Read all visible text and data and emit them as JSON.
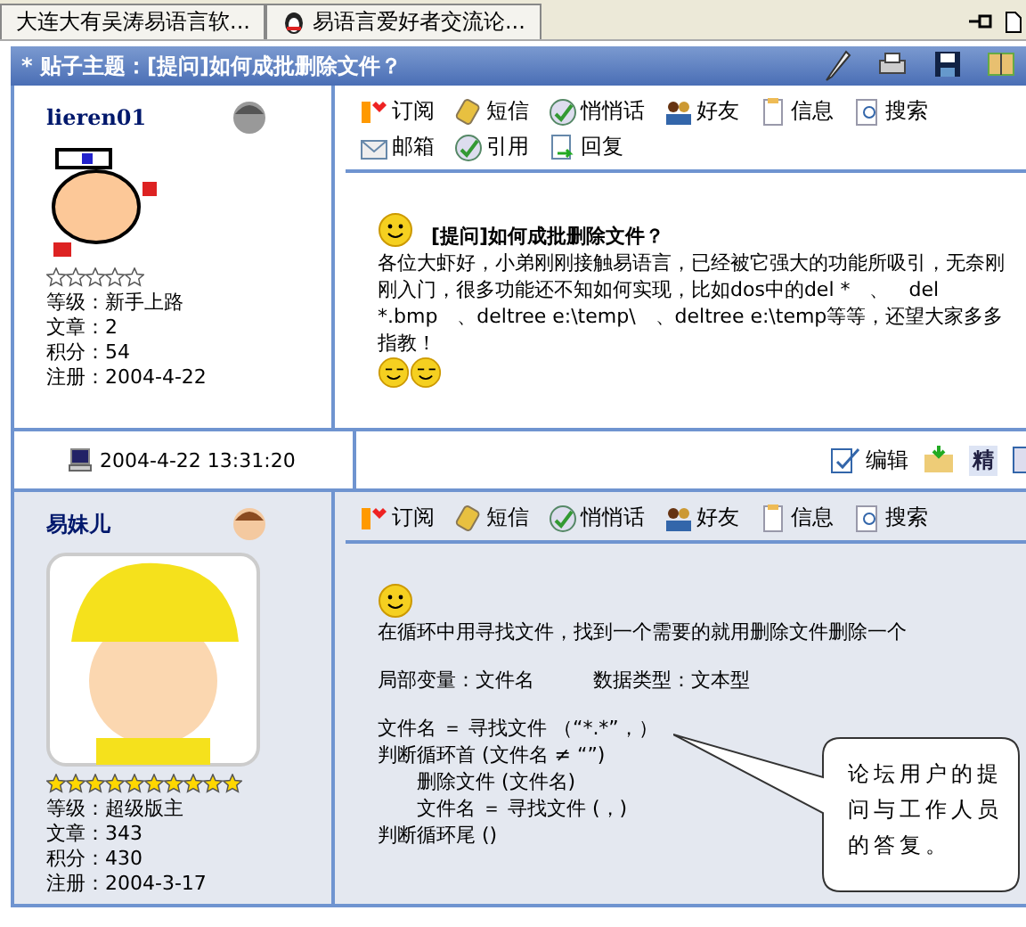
{
  "browser_tabs": [
    {
      "title": "大连大有吴涛易语言软...",
      "kind": "page"
    },
    {
      "title": "易语言爱好者交流论...",
      "kind": "penguin"
    }
  ],
  "topic_bar": {
    "title": "* 贴子主题：[提问]如何成批删除文件？"
  },
  "posts": [
    {
      "username": "lieren01",
      "kind": "pixel",
      "stars": 0,
      "stats": [
        "等级：新手上路",
        "文章：2",
        "积分：54",
        "注册：2004-4-22"
      ],
      "actions": [
        {
          "label": "订阅",
          "kind": "subscribe"
        },
        {
          "label": "短信",
          "kind": "phone"
        },
        {
          "label": "悄悄话",
          "kind": "whisper"
        },
        {
          "label": "好友",
          "kind": "friends"
        },
        {
          "label": "信息",
          "kind": "info"
        },
        {
          "label": "搜索",
          "kind": "search"
        },
        {
          "label": "邮箱",
          "kind": "mail"
        },
        {
          "label": "引用",
          "kind": "whisper"
        },
        {
          "label": "回复",
          "kind": "reply"
        }
      ],
      "title": "[提问]如何成批删除文件？",
      "paragraphs": [
        "各位大虾好，小弟刚刚接触易语言，已经被它强大的功能所吸引，无奈刚刚入门，很多功能还不知如何实现，比如dos中的del *　、　del *.bmp　、deltree e:\\temp\\　、deltree e:\\temp等等，还望大家多多指教！"
      ],
      "footer": {
        "time": "2004-4-22 13:31:20",
        "edit": "编辑",
        "best": "精"
      }
    },
    {
      "username": "易妹儿",
      "kind": "girl",
      "stars": 10,
      "stats": [
        "等级：超级版主",
        "文章：343",
        "积分：430",
        "注册：2004-3-17"
      ],
      "actions": [
        {
          "label": "订阅",
          "kind": "subscribe"
        },
        {
          "label": "短信",
          "kind": "phone"
        },
        {
          "label": "悄悄话",
          "kind": "whisper"
        },
        {
          "label": "好友",
          "kind": "friends"
        },
        {
          "label": "信息",
          "kind": "info"
        },
        {
          "label": "搜索",
          "kind": "search"
        }
      ],
      "paragraphs": [
        "在循环中用寻找文件，找到一个需要的就用删除文件删除一个",
        "局部变量：文件名　　　数据类型：文本型"
      ],
      "code": [
        {
          "text": "文件名 ＝ 寻找文件 （“*.*”，）"
        },
        {
          "text": "判断循环首 (文件名 ≠ “”)",
          "children": [
            {
              "text": "删除文件 (文件名)"
            },
            {
              "text": "文件名 ＝ 寻找文件 (，)"
            }
          ]
        },
        {
          "text": "判断循环尾 ()"
        }
      ]
    }
  ],
  "callout": {
    "text": "论坛用户的提问与工作人员的答复。"
  }
}
